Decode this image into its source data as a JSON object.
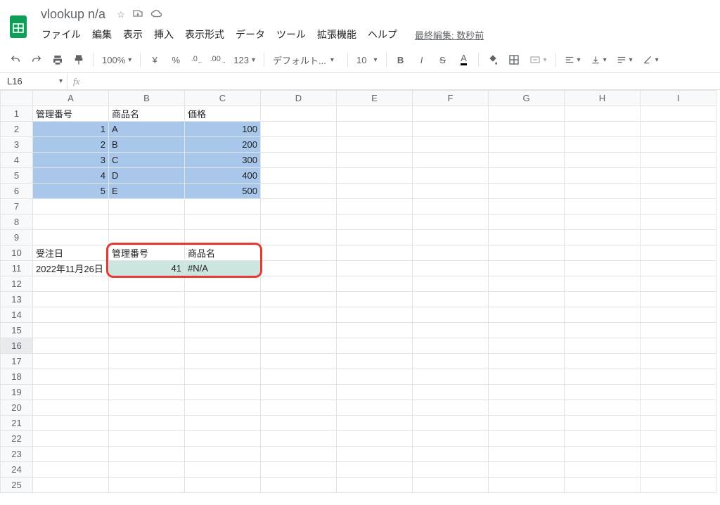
{
  "header": {
    "title": "vlookup n/a",
    "last_edit": "最終編集: 数秒前"
  },
  "menu": [
    "ファイル",
    "編集",
    "表示",
    "挿入",
    "表示形式",
    "データ",
    "ツール",
    "拡張機能",
    "ヘルプ"
  ],
  "toolbar": {
    "zoom": "100%",
    "currency": "¥",
    "percent": "%",
    "dec_dec": ".0",
    "dec_inc": ".00",
    "num_fmt": "123",
    "font": "デフォルト...",
    "size": "10",
    "bold": "B",
    "italic": "I",
    "strike": "S",
    "text_color": "A"
  },
  "namebox": {
    "ref": "L16",
    "fx": "fx"
  },
  "columns": [
    "A",
    "B",
    "C",
    "D",
    "E",
    "F",
    "G",
    "H",
    "I"
  ],
  "rows": 25,
  "data": {
    "1": {
      "A": "管理番号",
      "B": "商品名",
      "C": "価格"
    },
    "2": {
      "A": "1",
      "B": "A",
      "C": "100"
    },
    "3": {
      "A": "2",
      "B": "B",
      "C": "200"
    },
    "4": {
      "A": "3",
      "B": "C",
      "C": "300"
    },
    "5": {
      "A": "4",
      "B": "D",
      "C": "400"
    },
    "6": {
      "A": "5",
      "B": "E",
      "C": "500"
    },
    "10": {
      "A": "受注日",
      "B": "管理番号",
      "C": "商品名"
    },
    "11": {
      "A": "2022年11月26日",
      "B": "41",
      "C": "#N/A"
    }
  },
  "numeric_cells": [
    "A2",
    "A3",
    "A4",
    "A5",
    "A6",
    "C2",
    "C3",
    "C4",
    "C5",
    "C6",
    "B11"
  ],
  "blue_range": {
    "rows": [
      2,
      6
    ],
    "cols": [
      "A",
      "C"
    ]
  },
  "teal_range": {
    "rows": [
      11,
      11
    ],
    "cols": [
      "B",
      "C"
    ]
  },
  "selected_row": 16,
  "red_box": {
    "rows": [
      10,
      11
    ],
    "cols": [
      "B",
      "C"
    ]
  }
}
